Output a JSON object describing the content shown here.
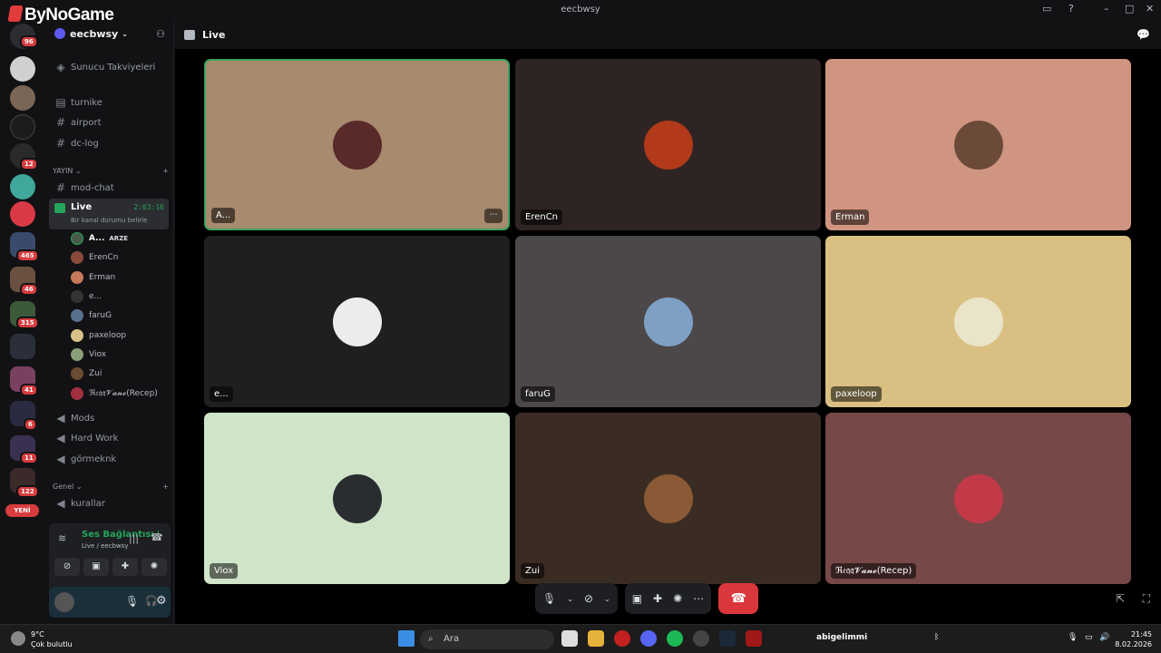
{
  "window": {
    "title": "eecbwsy",
    "logo": "ByNoGame"
  },
  "rail": {
    "badges": [
      "96",
      "12",
      "465",
      "46",
      "315",
      "41",
      "6",
      "11",
      "122"
    ],
    "new_label": "YENİ"
  },
  "sidebar": {
    "guild_name": "eecbwsy",
    "channels_top": [
      {
        "label": "Sunucu Takviyeleri",
        "icon": "boost-icon"
      },
      {
        "label": "turnike",
        "icon": "forum-icon"
      },
      {
        "label": "airport",
        "icon": "hash-icon"
      },
      {
        "label": "dc-log",
        "icon": "hash-icon"
      }
    ],
    "cat_yayin": "YAYIN",
    "mod_chat": "mod-chat",
    "live": {
      "name": "Live",
      "timer": "2:03:16",
      "status": "Bir kanal durumu belirle"
    },
    "voice_users": [
      {
        "name": "A...",
        "tag": "ARZE"
      },
      {
        "name": "ErenCn"
      },
      {
        "name": "Erman"
      },
      {
        "name": "e..."
      },
      {
        "name": "faruG"
      },
      {
        "name": "paxeloop"
      },
      {
        "name": "Viox"
      },
      {
        "name": "Zui"
      },
      {
        "name": "ℜ𝔢𝔮𝔮𝓥𝓪𝓷𝓮(Recep)"
      }
    ],
    "channels_bottom": [
      "Mods",
      "Hard Work",
      "görmeknk"
    ],
    "cat_genel": "Genel",
    "kurallar": "kurallar"
  },
  "voice_panel": {
    "status": "Ses Bağlantısı Kuru",
    "sub": "Live / eecbwsy"
  },
  "main": {
    "channel": "Live",
    "tiles": [
      {
        "name": "A...",
        "bg": "#a88a6e",
        "av": "#5a2a2a"
      },
      {
        "name": "ErenCn",
        "bg": "#2e2423",
        "av": "#b23a1a"
      },
      {
        "name": "Erman",
        "bg": "#d09580",
        "av": "#6b4a3a"
      },
      {
        "name": "e...",
        "bg": "#1f1f1f",
        "av": "#ececec"
      },
      {
        "name": "faruG",
        "bg": "#4c484a",
        "av": "#7ea0c4"
      },
      {
        "name": "paxeloop",
        "bg": "#d9c082",
        "av": "#eae4c8"
      },
      {
        "name": "Viox",
        "bg": "#cfe4c8",
        "av": "#2a2d30"
      },
      {
        "name": "Zui",
        "bg": "#3a2c23",
        "av": "#8a5a36"
      },
      {
        "name": "ℜ𝔢𝔮𝔮𝓥𝓪𝓷𝓮(Recep)",
        "bg": "#774848",
        "av": "#c23a48"
      }
    ]
  },
  "taskbar": {
    "weather_temp": "9°C",
    "weather_desc": "Çok bulutlu",
    "search": "Ara",
    "tray_user": "abigelimmi",
    "time": "21:45",
    "date": "8.02.2026"
  }
}
